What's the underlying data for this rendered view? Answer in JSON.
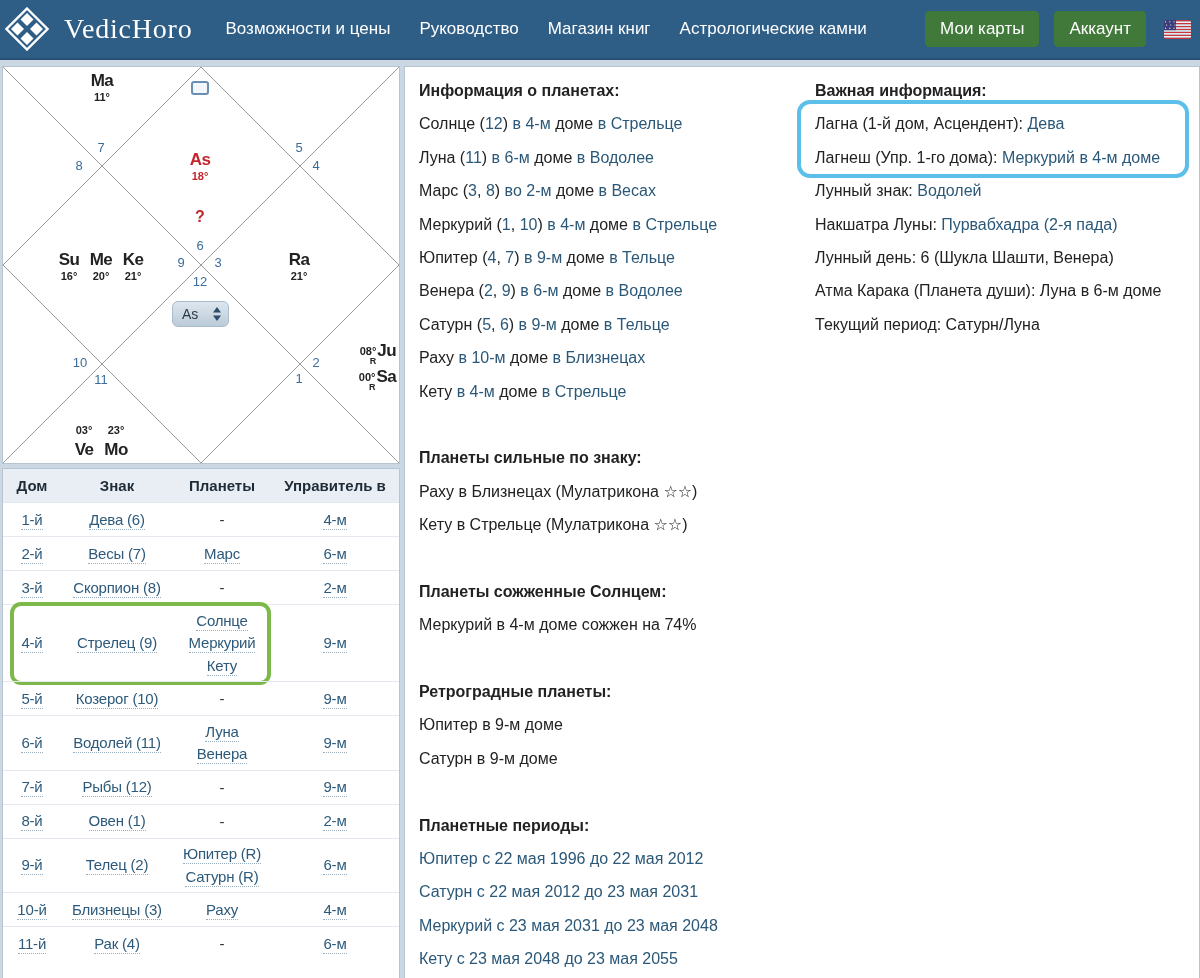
{
  "header": {
    "logo": "VedicHoro",
    "nav": [
      "Возможности и цены",
      "Руководство",
      "Магазин книг",
      "Астрологические камни"
    ],
    "buttons": [
      "Мои карты",
      "Аккаунт"
    ]
  },
  "chart": {
    "selector": "As",
    "houses": [
      {
        "sign": "6",
        "note": "?",
        "planets": [
          {
            "kind": "ascendant",
            "abbr": "As",
            "degree": "18°"
          }
        ]
      },
      {
        "sign": "7",
        "planets": [
          {
            "kind": "planet",
            "abbr": "Ma",
            "degree": "11°"
          }
        ]
      },
      {
        "sign": "8"
      },
      {
        "sign": "9",
        "planets": [
          {
            "kind": "planet",
            "abbr": "Su",
            "degree": "16°"
          },
          {
            "kind": "planet",
            "abbr": "Me",
            "degree": "20°"
          },
          {
            "kind": "planet",
            "abbr": "Ke",
            "degree": "21°"
          }
        ]
      },
      {
        "sign": "10"
      },
      {
        "sign": "11",
        "planets": [
          {
            "kind": "planet",
            "abbr": "Ve",
            "degree": "03°"
          },
          {
            "kind": "planet",
            "abbr": "Mo",
            "degree": "23°"
          }
        ]
      },
      {
        "sign": "12"
      },
      {
        "sign": "1"
      },
      {
        "sign": "2",
        "planets": [
          {
            "kind": "planet",
            "abbr": "Ju",
            "degree": "08°",
            "retro": "R"
          },
          {
            "kind": "planet",
            "abbr": "Sa",
            "degree": "00°",
            "retro": "R"
          }
        ]
      },
      {
        "sign": "3",
        "planets": [
          {
            "kind": "planet",
            "abbr": "Ra",
            "degree": "21°"
          }
        ]
      },
      {
        "sign": "4"
      },
      {
        "sign": "5"
      }
    ]
  },
  "house_table": {
    "columns": [
      "Дом",
      "Знак",
      "Планеты",
      "Управитель в"
    ],
    "rows": [
      {
        "house": "1-й",
        "sign": "Дева (6)",
        "planets": [
          {
            "text": "-",
            "kind": "dash"
          }
        ],
        "lord": "4-м",
        "highlighted": false
      },
      {
        "house": "2-й",
        "sign": "Весы (7)",
        "planets": [
          {
            "text": "Марс",
            "kind": "link"
          }
        ],
        "lord": "6-м",
        "highlighted": false
      },
      {
        "house": "3-й",
        "sign": "Скорпион (8)",
        "planets": [
          {
            "text": "-",
            "kind": "dash"
          }
        ],
        "lord": "2-м",
        "highlighted": false
      },
      {
        "house": "4-й",
        "sign": "Стрелец (9)",
        "planets": [
          {
            "text": "Солнце",
            "kind": "link"
          },
          {
            "text": "Меркурий",
            "kind": "link"
          },
          {
            "text": "Кету",
            "kind": "link"
          }
        ],
        "lord": "9-м",
        "highlighted": true
      },
      {
        "house": "5-й",
        "sign": "Козерог (10)",
        "planets": [
          {
            "text": "-",
            "kind": "dash"
          }
        ],
        "lord": "9-м",
        "highlighted": false
      },
      {
        "house": "6-й",
        "sign": "Водолей (11)",
        "planets": [
          {
            "text": "Луна",
            "kind": "link"
          },
          {
            "text": "Венера",
            "kind": "link"
          }
        ],
        "lord": "9-м",
        "highlighted": false
      },
      {
        "house": "7-й",
        "sign": "Рыбы (12)",
        "planets": [
          {
            "text": "-",
            "kind": "dash"
          }
        ],
        "lord": "9-м",
        "highlighted": false
      },
      {
        "house": "8-й",
        "sign": "Овен (1)",
        "planets": [
          {
            "text": "-",
            "kind": "dash"
          }
        ],
        "lord": "2-м",
        "highlighted": false
      },
      {
        "house": "9-й",
        "sign": "Телец (2)",
        "planets": [
          {
            "text": "Юпитер (R)",
            "kind": "link"
          },
          {
            "text": "Сатурн (R)",
            "kind": "link"
          }
        ],
        "lord": "6-м",
        "highlighted": false
      },
      {
        "house": "10-й",
        "sign": "Близнецы (3)",
        "planets": [
          {
            "text": "Раху",
            "kind": "link"
          }
        ],
        "lord": "4-м",
        "highlighted": false
      },
      {
        "house": "11-й",
        "sign": "Рак (4)",
        "planets": [
          {
            "text": "-",
            "kind": "dash"
          }
        ],
        "lord": "6-м",
        "highlighted": false
      }
    ]
  },
  "info_columns": [
    {
      "sections": [
        {
          "heading": "Информация о планетах:",
          "lines": [
            {
              "segments": [
                {
                  "text": "Солнце (",
                  "kind": "text"
                },
                {
                  "text": "12",
                  "kind": "link"
                },
                {
                  "text": ") ",
                  "kind": "text"
                },
                {
                  "text": "в 4-м",
                  "kind": "link"
                },
                {
                  "text": " доме ",
                  "kind": "text"
                },
                {
                  "text": "в Стрельце",
                  "kind": "link"
                }
              ]
            },
            {
              "segments": [
                {
                  "text": "Луна (",
                  "kind": "text"
                },
                {
                  "text": "11",
                  "kind": "link"
                },
                {
                  "text": ") ",
                  "kind": "text"
                },
                {
                  "text": "в 6-м",
                  "kind": "link"
                },
                {
                  "text": " доме ",
                  "kind": "text"
                },
                {
                  "text": "в Водолее",
                  "kind": "link"
                }
              ]
            },
            {
              "segments": [
                {
                  "text": "Марс (",
                  "kind": "text"
                },
                {
                  "text": "3",
                  "kind": "link"
                },
                {
                  "text": ", ",
                  "kind": "text"
                },
                {
                  "text": "8",
                  "kind": "link"
                },
                {
                  "text": ") ",
                  "kind": "text"
                },
                {
                  "text": "во 2-м",
                  "kind": "link"
                },
                {
                  "text": " доме ",
                  "kind": "text"
                },
                {
                  "text": "в Весах",
                  "kind": "link"
                }
              ]
            },
            {
              "segments": [
                {
                  "text": "Меркурий (",
                  "kind": "text"
                },
                {
                  "text": "1",
                  "kind": "link"
                },
                {
                  "text": ", ",
                  "kind": "text"
                },
                {
                  "text": "10",
                  "kind": "link"
                },
                {
                  "text": ") ",
                  "kind": "text"
                },
                {
                  "text": "в 4-м",
                  "kind": "link"
                },
                {
                  "text": " доме ",
                  "kind": "text"
                },
                {
                  "text": "в Стрельце",
                  "kind": "link"
                }
              ]
            },
            {
              "segments": [
                {
                  "text": "Юпитер (",
                  "kind": "text"
                },
                {
                  "text": "4",
                  "kind": "link"
                },
                {
                  "text": ", ",
                  "kind": "text"
                },
                {
                  "text": "7",
                  "kind": "link"
                },
                {
                  "text": ") ",
                  "kind": "text"
                },
                {
                  "text": "в 9-м",
                  "kind": "link"
                },
                {
                  "text": " доме ",
                  "kind": "text"
                },
                {
                  "text": "в Тельце",
                  "kind": "link"
                }
              ]
            },
            {
              "segments": [
                {
                  "text": "Венера (",
                  "kind": "text"
                },
                {
                  "text": "2",
                  "kind": "link"
                },
                {
                  "text": ", ",
                  "kind": "text"
                },
                {
                  "text": "9",
                  "kind": "link"
                },
                {
                  "text": ") ",
                  "kind": "text"
                },
                {
                  "text": "в 6-м",
                  "kind": "link"
                },
                {
                  "text": " доме ",
                  "kind": "text"
                },
                {
                  "text": "в Водолее",
                  "kind": "link"
                }
              ]
            },
            {
              "segments": [
                {
                  "text": "Сатурн (",
                  "kind": "text"
                },
                {
                  "text": "5",
                  "kind": "link"
                },
                {
                  "text": ", ",
                  "kind": "text"
                },
                {
                  "text": "6",
                  "kind": "link"
                },
                {
                  "text": ") ",
                  "kind": "text"
                },
                {
                  "text": "в 9-м",
                  "kind": "link"
                },
                {
                  "text": " доме ",
                  "kind": "text"
                },
                {
                  "text": "в Тельце",
                  "kind": "link"
                }
              ]
            },
            {
              "segments": [
                {
                  "text": "Раху ",
                  "kind": "text"
                },
                {
                  "text": "в 10-м",
                  "kind": "link"
                },
                {
                  "text": " доме ",
                  "kind": "text"
                },
                {
                  "text": "в Близнецах",
                  "kind": "link"
                }
              ]
            },
            {
              "segments": [
                {
                  "text": "Кету ",
                  "kind": "text"
                },
                {
                  "text": "в 4-м",
                  "kind": "link"
                },
                {
                  "text": " доме ",
                  "kind": "text"
                },
                {
                  "text": "в Стрельце",
                  "kind": "link"
                }
              ]
            }
          ]
        },
        {
          "heading": "Планеты сильные по знаку:",
          "lines": [
            {
              "segments": [
                {
                  "text": "Раху в Близнецах (Мулатрикона ☆☆)",
                  "kind": "text"
                }
              ]
            },
            {
              "segments": [
                {
                  "text": "Кету в Стрельце (Мулатрикона ☆☆)",
                  "kind": "text"
                }
              ]
            }
          ]
        },
        {
          "heading": "Планеты сожженные Солнцем:",
          "lines": [
            {
              "segments": [
                {
                  "text": "Меркурий в 4-м доме сожжен на 74%",
                  "kind": "text"
                }
              ]
            }
          ]
        },
        {
          "heading": "Ретроградные планеты:",
          "lines": [
            {
              "segments": [
                {
                  "text": "Юпитер в 9-м доме",
                  "kind": "text"
                }
              ]
            },
            {
              "segments": [
                {
                  "text": "Сатурн в 9-м доме",
                  "kind": "text"
                }
              ]
            }
          ]
        },
        {
          "heading": "Планетные периоды:",
          "lines": [
            {
              "segments": [
                {
                  "text": "Юпитер с 22 мая 1996 до 22 мая 2012",
                  "kind": "link"
                }
              ]
            },
            {
              "segments": [
                {
                  "text": "Сатурн с 22 мая 2012 до 23 мая 2031",
                  "kind": "link"
                }
              ]
            },
            {
              "segments": [
                {
                  "text": "Меркурий с 23 мая 2031 до 23 мая 2048",
                  "kind": "link"
                }
              ]
            },
            {
              "segments": [
                {
                  "text": "Кету с 23 мая 2048 до 23 мая 2055",
                  "kind": "link"
                }
              ]
            }
          ]
        }
      ]
    },
    {
      "sections": [
        {
          "heading": "Важная информация:",
          "lines": [
            {
              "segments": [
                {
                  "text": "Лагна (1-й дом, Асцендент): ",
                  "kind": "text"
                },
                {
                  "text": "Дева",
                  "kind": "link"
                }
              ],
              "highlighted": true
            },
            {
              "segments": [
                {
                  "text": "Лагнеш (Упр. 1-го дома): ",
                  "kind": "text"
                },
                {
                  "text": "Меркурий в 4-м доме",
                  "kind": "link"
                }
              ],
              "highlighted": true
            },
            {
              "segments": [
                {
                  "text": "Лунный знак: ",
                  "kind": "text"
                },
                {
                  "text": "Водолей",
                  "kind": "link"
                }
              ],
              "highlighted": false
            },
            {
              "segments": [
                {
                  "text": "Накшатра Луны: ",
                  "kind": "text"
                },
                {
                  "text": "Пурвабхадра (2-я пада)",
                  "kind": "link"
                }
              ],
              "highlighted": false
            },
            {
              "segments": [
                {
                  "text": "Лунный день: 6 (Шукла Шашти, Венера)",
                  "kind": "text"
                }
              ],
              "highlighted": false
            },
            {
              "segments": [
                {
                  "text": "Атма Карака (Планета души): Луна в 6-м доме",
                  "kind": "text"
                }
              ],
              "highlighted": false
            },
            {
              "segments": [
                {
                  "text": "Текущий период: Сатурн/Луна",
                  "kind": "text"
                }
              ],
              "highlighted": false
            }
          ]
        }
      ]
    }
  ]
}
